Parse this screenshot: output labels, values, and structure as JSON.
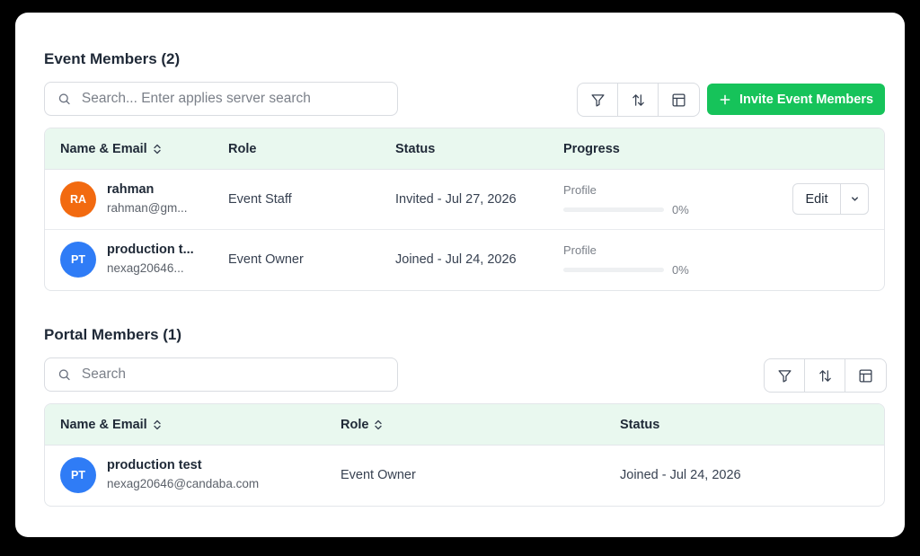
{
  "event_members": {
    "title": "Event Members (2)",
    "search_placeholder": "Search... Enter applies server search",
    "invite_label": "Invite Event Members",
    "columns": {
      "name_email": "Name & Email",
      "role": "Role",
      "status": "Status",
      "progress": "Progress"
    },
    "rows": [
      {
        "initials": "RA",
        "avatar_color": "#f26a10",
        "name": "rahman",
        "email": "rahman@gm...",
        "role": "Event Staff",
        "status": "Invited - Jul 27, 2026",
        "progress_label": "Profile",
        "progress_pct": "0%",
        "progress_value": 0,
        "edit_label": "Edit"
      },
      {
        "initials": "PT",
        "avatar_color": "#2f7cf6",
        "name": "production t...",
        "email": "nexag20646...",
        "role": "Event Owner",
        "status": "Joined - Jul 24, 2026",
        "progress_label": "Profile",
        "progress_pct": "0%",
        "progress_value": 0
      }
    ]
  },
  "portal_members": {
    "title": "Portal Members (1)",
    "search_placeholder": "Search",
    "columns": {
      "name_email": "Name & Email",
      "role": "Role",
      "status": "Status"
    },
    "rows": [
      {
        "initials": "PT",
        "avatar_color": "#2f7cf6",
        "name": "production test",
        "email": "nexag20646@candaba.com",
        "role": "Event Owner",
        "status": "Joined - Jul 24, 2026"
      }
    ]
  },
  "colors": {
    "accent": "#16c35a",
    "header_bg": "#e9f8ef"
  },
  "icons": [
    "search-icon",
    "filter-icon",
    "sort-icon",
    "columns-icon",
    "plus-icon",
    "sort-arrows-icon",
    "chevron-down-icon"
  ]
}
